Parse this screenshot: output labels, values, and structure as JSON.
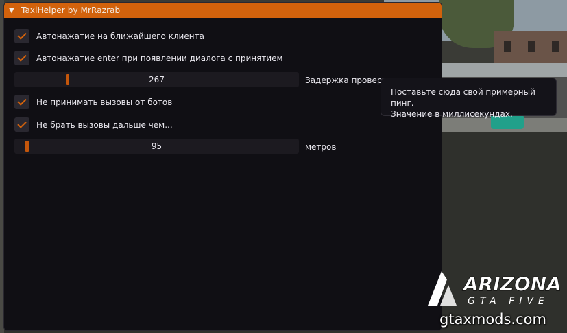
{
  "window": {
    "title": "TaxiHelper by MrRazrab",
    "accent_color": "#d2620c",
    "collapse_icon": "triangle-down-icon"
  },
  "options": {
    "auto_click_nearest": {
      "label": "Автонажатие на ближайшего клиента",
      "checked": true
    },
    "auto_enter": {
      "label": "Автонажатие enter при появлении диалога с принятием",
      "checked": true
    },
    "delay_slider": {
      "value": "267",
      "label": "Задержка проверки",
      "fraction": 0.182
    },
    "ignore_bots": {
      "label": "Не принимать вызовы от ботов",
      "checked": true
    },
    "distance_limit": {
      "label": "Не брать вызовы дальше чем...",
      "checked": true
    },
    "distance_slider": {
      "value": "95",
      "label": "метров",
      "fraction": 0.04
    }
  },
  "tooltip": {
    "line1": "Поставьте сюда свой примерный пинг.",
    "line2": "Значение в миллисекундах."
  },
  "watermark": {
    "logo_main": "ARIZONA",
    "logo_sub": "GTA FIVE",
    "site": "gtaxmods.com"
  }
}
